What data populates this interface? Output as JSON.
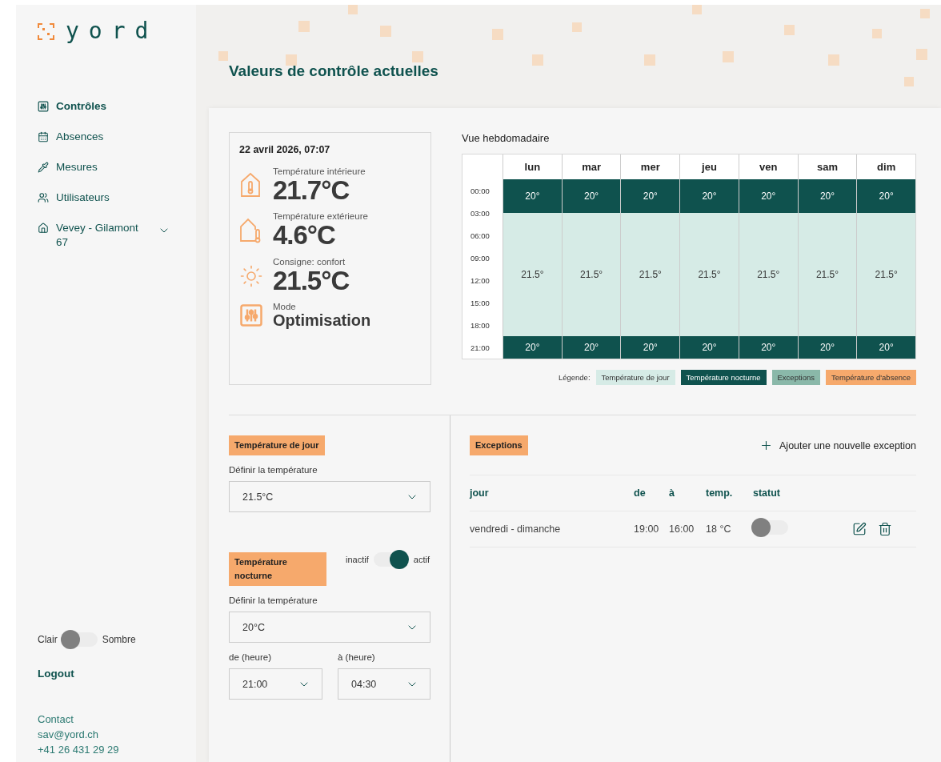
{
  "logo": {
    "text": "yord"
  },
  "sidebar": {
    "items": [
      {
        "label": "Contrôles",
        "kind": "page",
        "selected": true
      },
      {
        "label": "Absences",
        "kind": "page",
        "selected": false
      },
      {
        "label": "Mesures",
        "kind": "page",
        "selected": false
      },
      {
        "label": "Utilisateurs",
        "kind": "page",
        "selected": false
      },
      {
        "label": "Vevey - Gilamont 67",
        "kind": "location",
        "selected": false
      }
    ],
    "theme_toggle": {
      "left": "Clair",
      "right": "Sombre",
      "on": false
    },
    "logout": "Logout",
    "contact": {
      "title": "Contact",
      "email": "sav@yord.ch",
      "phone": "+41 26 431 29 29"
    }
  },
  "page_title": "Valeurs de contrôle actuelles",
  "current": {
    "datetime": "22 avril 2026, 07:07",
    "readings": [
      {
        "kind": "temperature",
        "label": "Température intérieure",
        "value": "21.7°C"
      },
      {
        "kind": "temperature",
        "label": "Température extérieure",
        "value": "4.6°C"
      },
      {
        "kind": "temperature",
        "label": "Consigne: confort",
        "value": "21.5°C"
      },
      {
        "kind": "mode",
        "label": "Mode",
        "value": "Optimisation"
      }
    ]
  },
  "weekly": {
    "title": "Vue hebdomadaire",
    "times": [
      "00:00",
      "03:00",
      "06:00",
      "09:00",
      "12:00",
      "15:00",
      "18:00",
      "21:00"
    ],
    "days": [
      {
        "name": "lun",
        "segments": [
          {
            "kind": "night",
            "value": "20°"
          },
          {
            "kind": "day",
            "value": "21.5°"
          },
          {
            "kind": "night",
            "value": "20°"
          }
        ]
      },
      {
        "name": "mar",
        "segments": [
          {
            "kind": "night",
            "value": "20°"
          },
          {
            "kind": "day",
            "value": "21.5°"
          },
          {
            "kind": "night",
            "value": "20°"
          }
        ]
      },
      {
        "name": "mer",
        "segments": [
          {
            "kind": "night",
            "value": "20°"
          },
          {
            "kind": "day",
            "value": "21.5°"
          },
          {
            "kind": "night",
            "value": "20°"
          }
        ]
      },
      {
        "name": "jeu",
        "segments": [
          {
            "kind": "night",
            "value": "20°"
          },
          {
            "kind": "day",
            "value": "21.5°"
          },
          {
            "kind": "night",
            "value": "20°"
          }
        ]
      },
      {
        "name": "ven",
        "segments": [
          {
            "kind": "night",
            "value": "20°"
          },
          {
            "kind": "day",
            "value": "21.5°"
          },
          {
            "kind": "night",
            "value": "20°"
          }
        ]
      },
      {
        "name": "sam",
        "segments": [
          {
            "kind": "night",
            "value": "20°"
          },
          {
            "kind": "day",
            "value": "21.5°"
          },
          {
            "kind": "night",
            "value": "20°"
          }
        ]
      },
      {
        "name": "dim",
        "segments": [
          {
            "kind": "night",
            "value": "20°"
          },
          {
            "kind": "day",
            "value": "21.5°"
          },
          {
            "kind": "night",
            "value": "20°"
          }
        ]
      }
    ],
    "legend_label": "Légende:",
    "legend": [
      {
        "label": "Température de jour",
        "color": "#d6ebe6"
      },
      {
        "label": "Température nocturne",
        "color": "#0f524e"
      },
      {
        "label": "Exceptions",
        "color": "#8ab8a9"
      },
      {
        "label": "Température d'absence",
        "color": "#f6a96c"
      }
    ]
  },
  "day_temp": {
    "tag": "Température de jour",
    "field_label": "Définir la température",
    "value": "21.5°C"
  },
  "night_temp": {
    "tag": "Température nocturne",
    "toggle": {
      "left": "inactif",
      "right": "actif",
      "on": true
    },
    "field_label": "Définir la température",
    "value": "20°C",
    "from_label": "de (heure)",
    "from": "21:00",
    "to_label": "à (heure)",
    "to": "04:30"
  },
  "exceptions": {
    "tag": "Exceptions",
    "add": "Ajouter une nouvelle exception",
    "columns": [
      "jour",
      "de",
      "à",
      "temp.",
      "statut"
    ],
    "rows": [
      {
        "cells": [
          "vendredi - dimanche",
          "19:00",
          "16:00",
          "18 °C"
        ],
        "on": false
      }
    ]
  }
}
